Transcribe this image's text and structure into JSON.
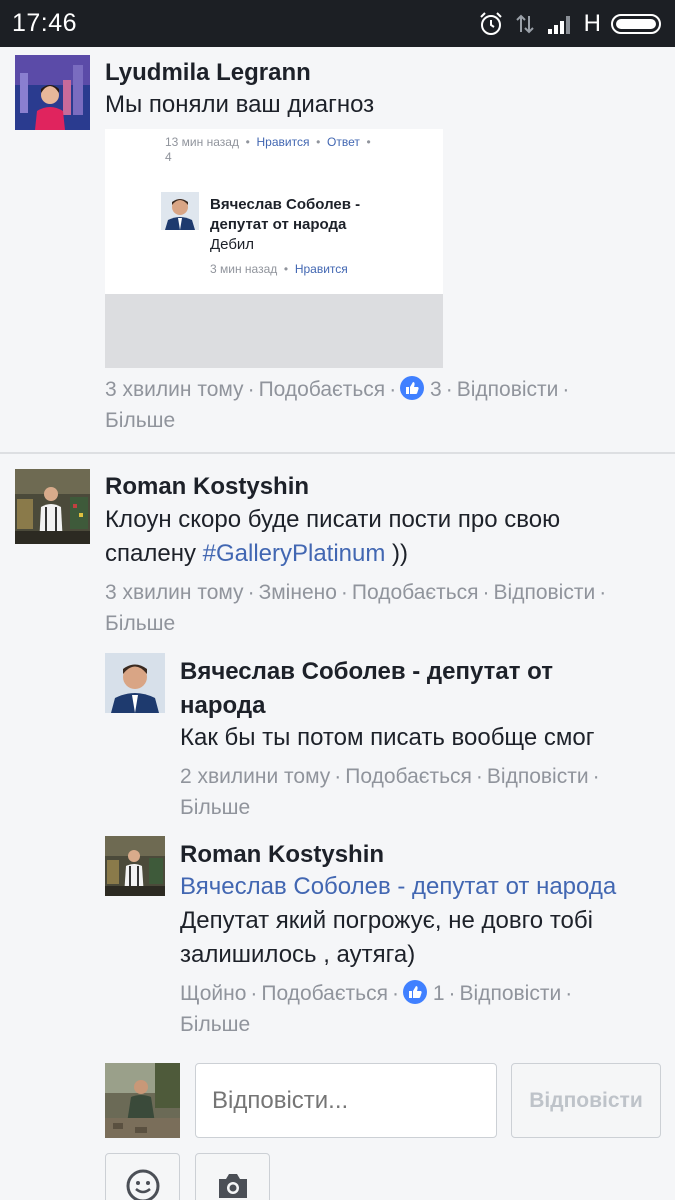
{
  "status_bar": {
    "time": "17:46",
    "network_label": "H",
    "icons": [
      "alarm-icon",
      "data-transfer-icon",
      "signal-icon",
      "battery-icon"
    ]
  },
  "colors": {
    "link": "#4267b2",
    "meta": "#90949c",
    "like": "#4080ff",
    "statusbar": "#1c1f24"
  },
  "comments": [
    {
      "author": "Lyudmila Legrann",
      "text": "Мы поняли ваш диагноз",
      "attachment": {
        "meta_line1_time": "13 мин назад",
        "meta_line1_like": "Нравится",
        "meta_line1_reply": "Ответ",
        "meta_line2": "4",
        "inner_author": "Вячеслав Соболев - депутат от народа",
        "inner_text": "Дебил",
        "inner_time": "3 мин назад",
        "inner_like": "Нравится"
      },
      "time": "3 хвилин тому",
      "like": "Подобається",
      "like_count": "3",
      "reply": "Відповісти",
      "more": "Більше"
    },
    {
      "author": "Roman Kostyshin",
      "text_before": "Клоун скоро буде писати пости про свою спалену ",
      "hashtag": "#GalleryPlatinum",
      "text_after": " ))",
      "time": "3 хвилин тому",
      "edited": "Змінено",
      "like": "Подобається",
      "reply": "Відповісти",
      "more": "Більше",
      "replies": [
        {
          "author": "Вячеслав Соболев - депутат от народа",
          "text": "Как бы ты потом писать вообще смог",
          "time": "2 хвилини тому",
          "like": "Подобається",
          "reply": "Відповісти",
          "more": "Більше"
        },
        {
          "author": "Roman Kostyshin",
          "mention": "Вячеслав Соболев - депутат от народа",
          "text": "Депутат який погрожує, не довго тобі залишилось , аутяга)",
          "time": "Щойно",
          "like": "Подобається",
          "like_count": "1",
          "reply": "Відповісти",
          "more": "Більше"
        }
      ]
    }
  ],
  "composer": {
    "placeholder": "Відповісти...",
    "button": "Відповісти",
    "tools": [
      "emoji-icon",
      "camera-icon"
    ]
  }
}
